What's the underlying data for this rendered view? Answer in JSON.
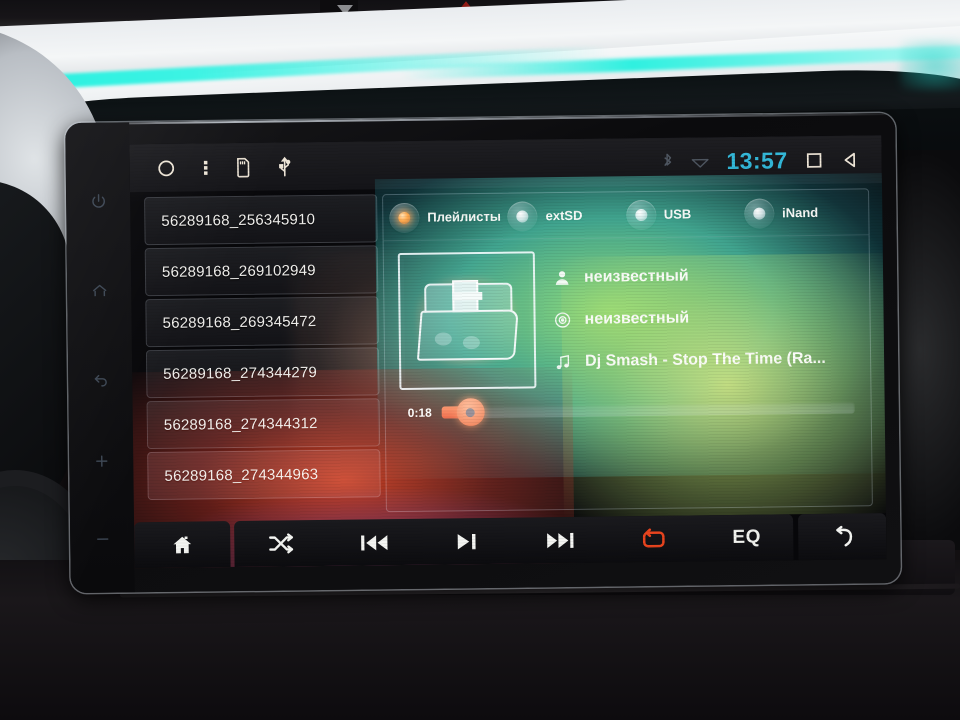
{
  "device": {
    "type": "android-car-head-unit",
    "hardware_keys": [
      {
        "name": "power",
        "glyph": "power-icon"
      },
      {
        "name": "home",
        "glyph": "home-outline-icon"
      },
      {
        "name": "back",
        "glyph": "back-arrow-icon"
      },
      {
        "name": "volume-up",
        "glyph": "plus-icon"
      },
      {
        "name": "volume-down",
        "glyph": "minus-icon"
      }
    ]
  },
  "statusbar": {
    "left_icons": [
      "circle-home-icon",
      "overflow-menu-icon",
      "sd-card-icon",
      "usb-icon"
    ],
    "bluetooth_icon": "bluetooth-icon",
    "wifi_icon": "wifi-icon",
    "time": "13:57",
    "recents_icon": "square-recents-icon",
    "back_icon": "back-triangle-icon"
  },
  "playlist": {
    "items": [
      {
        "label": "56289168_256345910",
        "selected": false
      },
      {
        "label": "56289168_269102949",
        "selected": false
      },
      {
        "label": "56289168_269345472",
        "selected": false
      },
      {
        "label": "56289168_274344279",
        "selected": false
      },
      {
        "label": "56289168_274344312",
        "selected": false
      },
      {
        "label": "56289168_274344963",
        "selected": true
      }
    ]
  },
  "sources": {
    "tabs": [
      {
        "label": "Плейлисты",
        "active": true
      },
      {
        "label": "extSD",
        "active": false
      },
      {
        "label": "USB",
        "active": false
      },
      {
        "label": "iNand",
        "active": false
      }
    ],
    "active_led_color": "#ff8a10"
  },
  "now_playing": {
    "album_art": "music-folder-icon",
    "artist": "неизвестный",
    "album": "неизвестный",
    "title": "Dj Smash - Stop The Time (Ra...",
    "artist_icon": "person-icon",
    "album_icon": "disc-icon",
    "title_icon": "music-note-icon",
    "current_time": "0:18",
    "progress_percent": 7
  },
  "controls": {
    "home": {
      "label": "home-icon",
      "active": false
    },
    "shuffle": {
      "label": "shuffle-icon",
      "active": false
    },
    "previous": {
      "label": "previous-track-icon",
      "active": false
    },
    "play_pause": {
      "label": "play-pause-icon",
      "active": false
    },
    "next": {
      "label": "next-track-icon",
      "active": false
    },
    "repeat": {
      "label": "repeat-icon",
      "active": true
    },
    "eq": {
      "label": "EQ",
      "active": false
    },
    "back": {
      "label": "return-arrow-icon",
      "active": false
    }
  },
  "colors": {
    "accent_active": "#e8441e",
    "time_text": "#2db6d8",
    "text_primary": "#f4f3f0",
    "panel_bg": "#121216"
  }
}
